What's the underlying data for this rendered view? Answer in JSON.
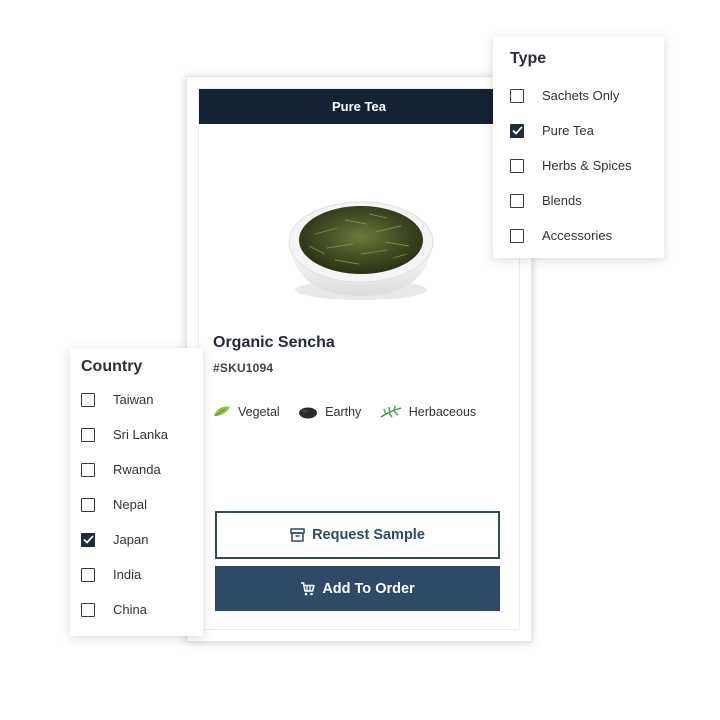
{
  "product": {
    "banner": "Pure Tea",
    "title": "Organic Sencha",
    "sku": "#SKU1094",
    "tags": [
      {
        "label": "Vegetal",
        "icon": "leaf-icon"
      },
      {
        "label": "Earthy",
        "icon": "soil-icon"
      },
      {
        "label": "Herbaceous",
        "icon": "herb-icon"
      }
    ],
    "request_sample_label": "Request Sample",
    "add_to_order_label": "Add To Order"
  },
  "type_filter": {
    "title": "Type",
    "options": [
      {
        "label": "Sachets Only",
        "checked": false
      },
      {
        "label": "Pure Tea",
        "checked": true
      },
      {
        "label": "Herbs & Spices",
        "checked": false
      },
      {
        "label": "Blends",
        "checked": false
      },
      {
        "label": "Accessories",
        "checked": false
      }
    ]
  },
  "country_filter": {
    "title": "Country",
    "options": [
      {
        "label": "Taiwan",
        "checked": false
      },
      {
        "label": "Sri Lanka",
        "checked": false
      },
      {
        "label": "Rwanda",
        "checked": false
      },
      {
        "label": "Nepal",
        "checked": false
      },
      {
        "label": "Japan",
        "checked": true
      },
      {
        "label": "India",
        "checked": false
      },
      {
        "label": "China",
        "checked": false
      }
    ]
  },
  "colors": {
    "banner_bg": "#152234",
    "button_primary": "#2f4a68",
    "checkbox_checked": "#1c2b3e"
  }
}
